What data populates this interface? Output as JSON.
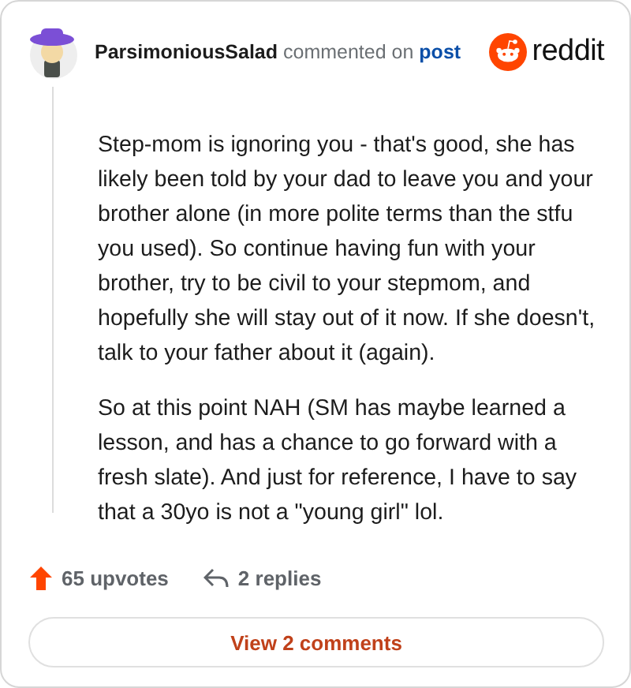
{
  "comment": {
    "author": "ParsimoniousSalad",
    "action": "commented on",
    "target": "post",
    "brand": "reddit"
  },
  "paragraphs": [
    "Step-mom is ignoring you - that's good, she has likely been told by your dad to leave you and your brother alone (in more polite terms than the stfu you used). So continue having fun with your brother, try to be civil to your stepmom, and hopefully she will stay out of it now. If she doesn't, talk to your father about it (again).",
    "So at this point NAH (SM has maybe learned a lesson, and has a chance to go forward with a fresh slate). And just for reference, I have to say that a 30yo is not a \"young girl\" lol."
  ],
  "stats": {
    "upvotes": "65 upvotes",
    "replies": "2 replies"
  },
  "button": "View 2 comments"
}
